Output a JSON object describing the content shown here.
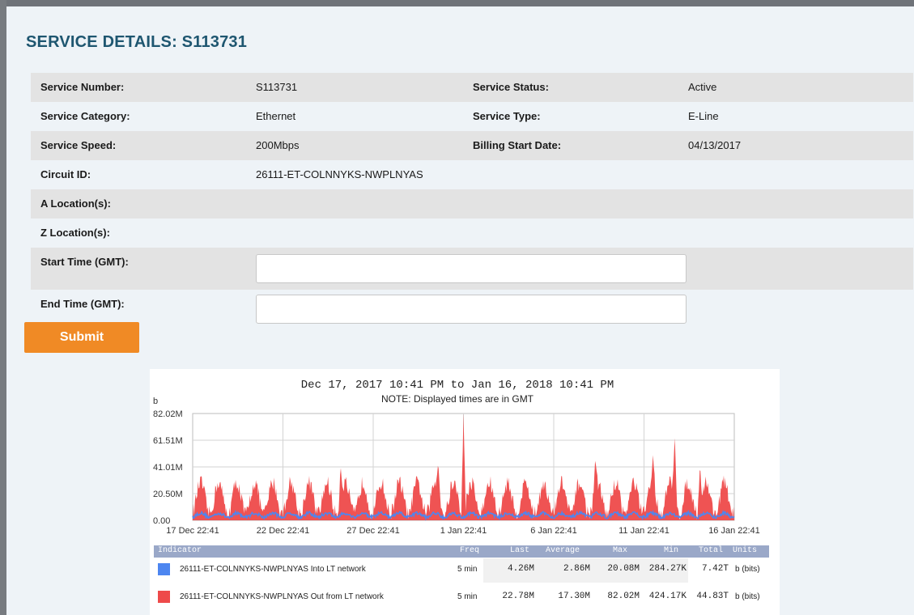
{
  "page": {
    "title": "SERVICE DETAILS: S113731"
  },
  "details": {
    "service_number": {
      "label": "Service Number:",
      "value": "S113731"
    },
    "service_status": {
      "label": "Service Status:",
      "value": "Active"
    },
    "service_category": {
      "label": "Service Category:",
      "value": "Ethernet"
    },
    "service_type": {
      "label": "Service Type:",
      "value": "E-Line"
    },
    "service_speed": {
      "label": "Service Speed:",
      "value": "200Mbps"
    },
    "billing_start_date": {
      "label": "Billing Start Date:",
      "value": "04/13/2017"
    },
    "circuit_id": {
      "label": "Circuit ID:",
      "value": "26111-ET-COLNNYKS-NWPLNYAS"
    },
    "a_location": {
      "label": "A Location(s):",
      "value": ""
    },
    "z_location": {
      "label": "Z Location(s):",
      "value": ""
    }
  },
  "form": {
    "start_time": {
      "label": "Start Time (GMT):",
      "value": "",
      "placeholder": ""
    },
    "end_time": {
      "label": "End Time (GMT):",
      "value": "",
      "placeholder": ""
    },
    "submit_label": "Submit"
  },
  "colors": {
    "accent": "#f08a25",
    "title": "#1e5670",
    "series_in": "#4d86f0",
    "series_out": "#ee4a4a"
  },
  "chart_data": {
    "type": "area",
    "title": "Dec 17, 2017 10:41 PM to Jan 16, 2018 10:41 PM",
    "subtitle": "NOTE: Displayed times are in GMT",
    "ylabel": "b",
    "y_ticks": [
      "0.00",
      "20.50M",
      "41.01M",
      "61.51M",
      "82.02M"
    ],
    "ylim": [
      0,
      82.02
    ],
    "y_unit": "M",
    "x_ticks": [
      "17 Dec 22:41",
      "22 Dec 22:41",
      "27 Dec 22:41",
      "1 Jan 22:41",
      "6 Jan 22:41",
      "11 Jan 22:41",
      "16 Jan 22:41"
    ],
    "xlim_days": [
      0,
      30
    ],
    "grid": true,
    "spikes": [
      {
        "day": 15.0,
        "value": 82.02
      },
      {
        "day": 13.6,
        "value": 45.5
      },
      {
        "day": 8.2,
        "value": 42.0
      },
      {
        "day": 22.3,
        "value": 47.0
      },
      {
        "day": 26.7,
        "value": 67.0
      },
      {
        "day": 25.5,
        "value": 50.0
      },
      {
        "day": 28.1,
        "value": 44.0
      }
    ],
    "legend_columns": [
      "Indicator",
      "Freq",
      "Last",
      "Average",
      "Max",
      "Min",
      "Total",
      "Units"
    ],
    "series": [
      {
        "name": "26111-ET-COLNNYKS-NWPLNYAS Into LT network",
        "color": "#4d86f0",
        "freq": "5 min",
        "last": "4.26M",
        "average": "2.86M",
        "max": "20.08M",
        "min": "284.27K",
        "total": "7.42T",
        "units": "b (bits)",
        "peak_value": 20.08,
        "avg_value": 2.86
      },
      {
        "name": "26111-ET-COLNNYKS-NWPLNYAS Out from LT network",
        "color": "#ee4a4a",
        "freq": "5 min",
        "last": "22.78M",
        "average": "17.30M",
        "max": "82.02M",
        "min": "424.17K",
        "total": "44.83T",
        "units": "b (bits)",
        "peak_value": 82.02,
        "avg_value": 17.3
      }
    ]
  }
}
